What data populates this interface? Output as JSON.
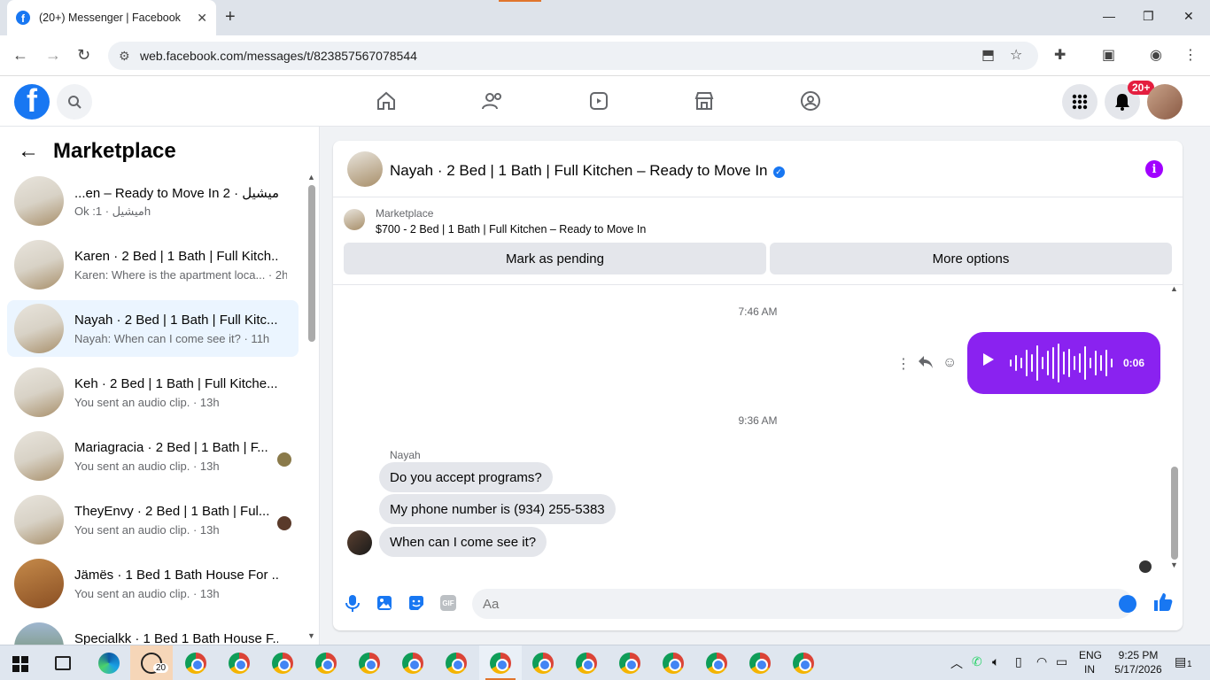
{
  "browser": {
    "tab_title": "(20+) Messenger | Facebook",
    "url": "web.facebook.com/messages/t/823857567078544"
  },
  "header": {
    "notification_badge": "20+"
  },
  "sidebar": {
    "title": "Marketplace",
    "conversations": [
      {
        "name": "...en – Ready to Move In 2 · ميشيل",
        "sub": "Ok :ميشيل · 1h"
      },
      {
        "name": "Karen · 2 Bed | 1 Bath | Full Kitch...",
        "sub": "Karen: Where is the apartment loca... · 2h"
      },
      {
        "name": "Nayah · 2 Bed | 1 Bath | Full Kitc...",
        "sub": "Nayah: When can I come see it? · 11h"
      },
      {
        "name": "Keh · 2 Bed | 1 Bath | Full Kitche...",
        "sub": "You sent an audio clip. · 13h"
      },
      {
        "name": "Mariagracia · 2 Bed | 1 Bath | F...",
        "sub": "You sent an audio clip. · 13h"
      },
      {
        "name": "TheyEnvy · 2 Bed | 1 Bath | Ful...",
        "sub": "You sent an audio clip. · 13h"
      },
      {
        "name": "Jämës · 1 Bed 1 Bath House For ...",
        "sub": "You sent an audio clip. · 13h"
      },
      {
        "name": "Specialkk · 1 Bed 1 Bath House F...",
        "sub": ""
      }
    ]
  },
  "chat": {
    "title": "Nayah · 2 Bed | 1 Bath | Full Kitchen – Ready to Move In",
    "marketplace_label": "Marketplace",
    "listing": "$700 - 2 Bed | 1 Bath | Full Kitchen – Ready to Move In",
    "mark_pending": "Mark as pending",
    "more_options": "More options",
    "timestamp1": "7:46 AM",
    "audio_duration": "0:06",
    "timestamp2": "9:36 AM",
    "sender": "Nayah",
    "messages": [
      "Do you accept programs?",
      "My phone number is (934) 255-5383",
      "When can I come see it?"
    ],
    "compose_placeholder": "Aa",
    "gif_label": "GIF"
  },
  "taskbar": {
    "whatsapp_count": "20",
    "lang": "ENG",
    "region": "IN",
    "time": "9:25 PM",
    "date": "5/17/2026",
    "notif_count": "1"
  },
  "colors": {
    "fb_blue": "#1877f2",
    "audio_purple": "#8a22f0",
    "info_purple": "#a100ff",
    "badge_red": "#e41e3f"
  }
}
